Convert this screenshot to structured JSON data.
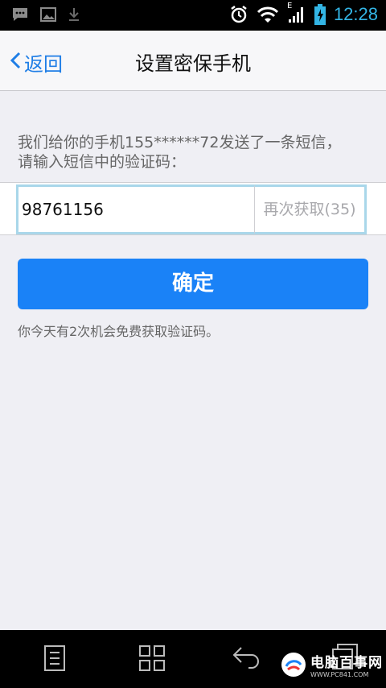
{
  "status_bar": {
    "time": "12:28",
    "network_label": "E",
    "icons": [
      "message-icon",
      "image-icon",
      "download-icon",
      "alarm-icon",
      "wifi-icon",
      "signal-icon",
      "battery-icon"
    ]
  },
  "header": {
    "back_label": "返回",
    "title": "设置密保手机"
  },
  "prompt": {
    "line1": "我们给你的手机155******72发送了一条短信，",
    "line2": "请输入短信中的验证码："
  },
  "verify": {
    "code_value": "98761156",
    "resend_label": "再次获取(35)"
  },
  "confirm_label": "确定",
  "hint": "你今天有2次机会免费获取验证码。",
  "nav": {
    "icons": [
      "menu-icon",
      "apps-icon",
      "back-icon",
      "recent-icon"
    ]
  },
  "watermark": {
    "title": "电脑百事网",
    "subtitle": "WWW.PC841.COM"
  },
  "colors": {
    "accent": "#1a82f7",
    "link": "#1f7ee6",
    "status": "#33b5e5"
  }
}
